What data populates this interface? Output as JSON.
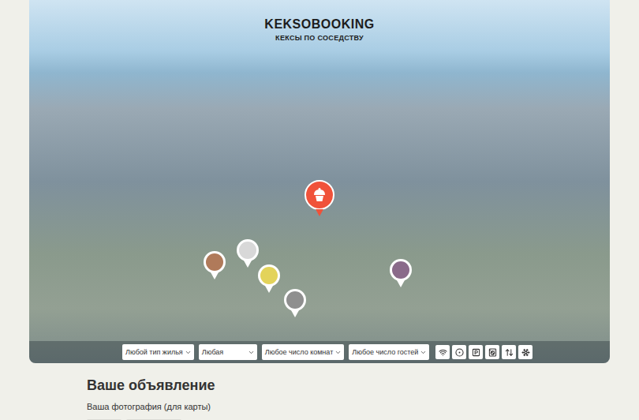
{
  "header": {
    "logo": "KEKSOBOOKING",
    "tagline": "КЕКСЫ ПО СОСЕДСТВУ"
  },
  "pins": [
    {
      "kind": "main"
    },
    {
      "kind": "offer"
    },
    {
      "kind": "offer"
    },
    {
      "kind": "offer"
    },
    {
      "kind": "offer"
    },
    {
      "kind": "offer"
    }
  ],
  "filters": [
    {
      "value": "Любой тип жилья"
    },
    {
      "value": "Любая"
    },
    {
      "value": "Любое число комнат"
    },
    {
      "value": "Любое число гостей"
    }
  ],
  "features": [
    {
      "kind": "wifi",
      "checked": false
    },
    {
      "kind": "dishwasher",
      "checked": false
    },
    {
      "kind": "parking",
      "checked": false
    },
    {
      "kind": "washer",
      "checked": false
    },
    {
      "kind": "elevator",
      "checked": false
    },
    {
      "kind": "conditioner",
      "checked": false
    }
  ],
  "form": {
    "title": "Ваше объявление",
    "photo_label": "Ваша фотография (для карты)"
  }
}
